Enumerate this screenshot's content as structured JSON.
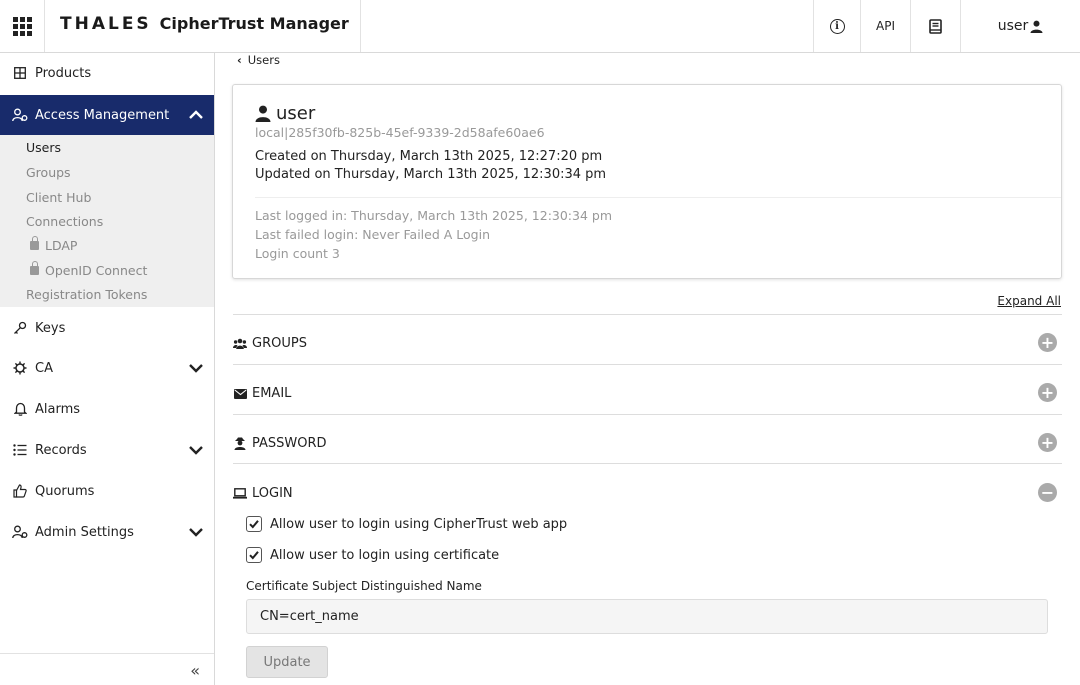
{
  "header": {
    "brand_company": "THALES",
    "brand_product": "CipherTrust Manager",
    "api_label": "API",
    "user_label": "user",
    "icons": {
      "apps": "apps-grid-icon",
      "info": "info-icon",
      "docs": "book-icon",
      "user": "user-icon"
    }
  },
  "sidebar": {
    "items": [
      {
        "label": "Products",
        "icon": "products-grid-icon"
      },
      {
        "label": "Access Management",
        "icon": "users-gear-icon"
      },
      {
        "label": "Keys",
        "icon": "key-icon"
      },
      {
        "label": "CA",
        "icon": "gear-icon"
      },
      {
        "label": "Alarms",
        "icon": "bell-icon"
      },
      {
        "label": "Records",
        "icon": "list-icon"
      },
      {
        "label": "Quorums",
        "icon": "thumbs-up-icon"
      },
      {
        "label": "Admin Settings",
        "icon": "admin-icon"
      }
    ],
    "sub_items": [
      {
        "label": "Users"
      },
      {
        "label": "Groups"
      },
      {
        "label": "Client Hub"
      },
      {
        "label": "Connections"
      },
      {
        "label": "LDAP"
      },
      {
        "label": "OpenID Connect"
      },
      {
        "label": "Registration Tokens"
      }
    ],
    "collapse_label": "«"
  },
  "main": {
    "back_label": "Users",
    "user": {
      "name": "user",
      "id": "local|285f30fb-825b-45ef-9339-2d58afe60ae6",
      "created": "Created on Thursday, March 13th 2025, 12:27:20 pm",
      "updated": "Updated on Thursday, March 13th 2025, 12:30:34 pm",
      "last_logged": "Last logged in: Thursday, March 13th 2025, 12:30:34 pm",
      "last_failed": "Last failed login: Never Failed A Login",
      "login_count": "Login count 3"
    },
    "expand_all": "Expand All",
    "sections": [
      {
        "label": "GROUPS",
        "icon": "users-icon",
        "expanded": false
      },
      {
        "label": "EMAIL",
        "icon": "envelope-icon",
        "expanded": false
      },
      {
        "label": "PASSWORD",
        "icon": "user-secret-icon",
        "expanded": false
      },
      {
        "label": "LOGIN",
        "icon": "laptop-icon",
        "expanded": true
      }
    ],
    "login": {
      "allow_web": "Allow user to login using CipherTrust web app",
      "allow_cert": "Allow user to login using certificate",
      "cert_label": "Certificate Subject Distinguished Name",
      "cert_value": "CN=cert_name",
      "update_label": "Update"
    }
  }
}
